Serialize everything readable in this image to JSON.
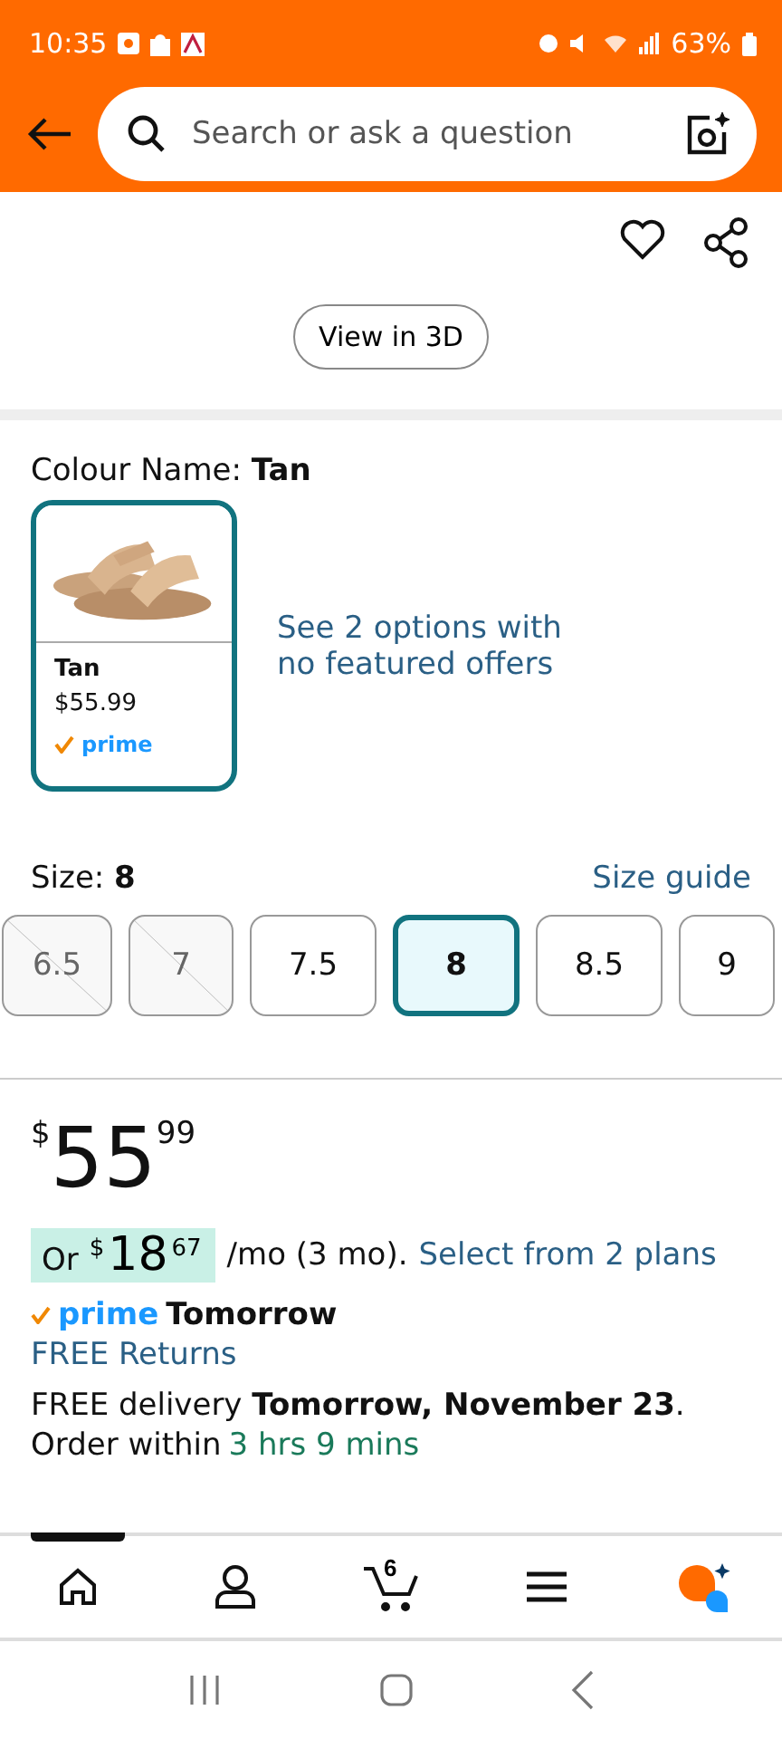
{
  "status_bar": {
    "time": "10:35",
    "battery": "63%"
  },
  "search": {
    "placeholder": "Search or ask a question"
  },
  "view_3d": {
    "label": "View in 3D"
  },
  "colour": {
    "label": "Colour Name:",
    "value": "Tan"
  },
  "swatches": [
    {
      "name": "Tan",
      "price": "$55.99",
      "prime": "prime",
      "selected": true,
      "kind": "picture"
    }
  ],
  "more_options": "See 2 options with no featured offers",
  "size": {
    "label": "Size:",
    "value": "8",
    "guide": "Size guide"
  },
  "sizes": [
    {
      "label": "6.5",
      "selected": false,
      "available": false
    },
    {
      "label": "7",
      "selected": false,
      "available": false
    },
    {
      "label": "7.5",
      "selected": false,
      "available": true
    },
    {
      "label": "8",
      "selected": true,
      "available": true
    },
    {
      "label": "8.5",
      "selected": false,
      "available": true
    },
    {
      "label": "9",
      "selected": false,
      "available": true
    }
  ],
  "price": {
    "symbol": "$",
    "whole": "55",
    "fraction": "99"
  },
  "installment": {
    "prefix": "Or",
    "symbol": "$",
    "whole": "18",
    "fraction": "67",
    "suffix": "/mo (3 mo).",
    "link": "Select from 2 plans"
  },
  "prime_delivery": {
    "logo": "prime",
    "day": "Tomorrow"
  },
  "returns": "FREE Returns",
  "delivery": "FREE delivery **Tomorrow, November 23**.",
  "order_within": {
    "text": "Order within",
    "countdown": "3 hrs 9 mins"
  },
  "bottom_nav": [
    {
      "kind": "home",
      "selected": true
    },
    {
      "kind": "account",
      "selected": false
    },
    {
      "kind": "cart",
      "badge": "6",
      "selected": false
    },
    {
      "kind": "menu",
      "selected": false
    },
    {
      "kind": "assistant",
      "selected": false
    }
  ]
}
